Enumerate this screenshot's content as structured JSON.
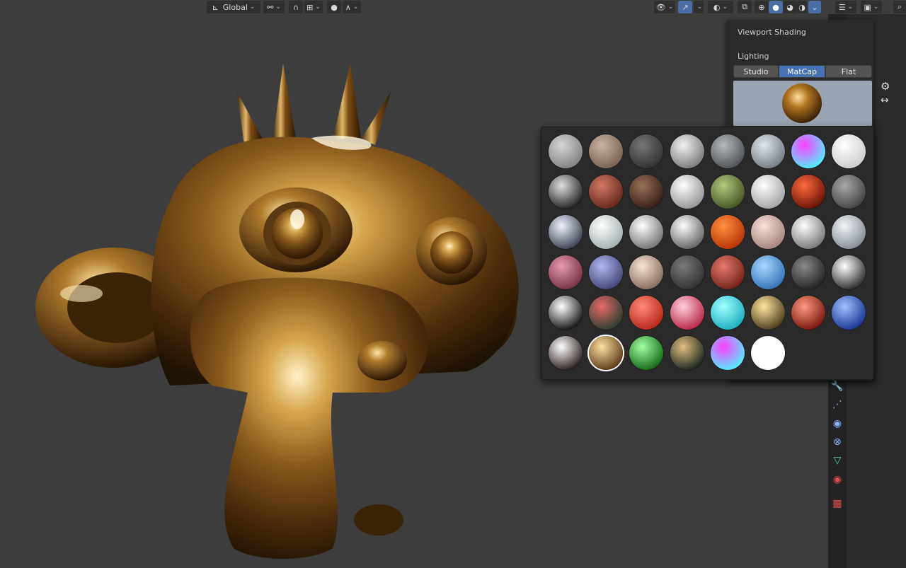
{
  "header": {
    "orientation_label": "Global",
    "icons": [
      "transform-orientation-icon",
      "pivot-icon",
      "snap-icon",
      "snap-target-icon",
      "proportional-edit-icon",
      "falloff-icon",
      "visibility-icon",
      "gizmo-icon",
      "overlay-icon",
      "xray-icon",
      "wireframe-shading-icon",
      "solid-shading-icon",
      "material-shading-icon",
      "rendered-shading-icon",
      "shading-options-icon",
      "outliner-filter-icon",
      "editor-type-icon",
      "search-icon"
    ]
  },
  "shading_popover": {
    "title": "Viewport Shading",
    "lighting_label": "Lighting",
    "lighting_options": [
      "Studio",
      "MatCap",
      "Flat"
    ],
    "active_lighting": "MatCap"
  },
  "matcap_grid": {
    "selected_index": 41,
    "colors": [
      [
        "#d6d6d6",
        "#7a7a7a"
      ],
      [
        "#c9b3a3",
        "#6e5a4c"
      ],
      [
        "#777777",
        "#2a2a2a"
      ],
      [
        "#f2f2f2",
        "#707070"
      ],
      [
        "#b5b9be",
        "#45484c"
      ],
      [
        "#e0e6ec",
        "#6a727a"
      ],
      [
        "#ff40ff",
        "#40ffff"
      ],
      [
        "#ffffff",
        "#c8c8c8"
      ],
      [
        "#e0e0e0",
        "#111111"
      ],
      [
        "#d27a64",
        "#5a1e16"
      ],
      [
        "#9a7058",
        "#2a1812"
      ],
      [
        "#ffffff",
        "#8a8a8a"
      ],
      [
        "#b4c87a",
        "#3a4a20"
      ],
      [
        "#ffffff",
        "#9a9a9a"
      ],
      [
        "#ff6a3c",
        "#5a0a00"
      ],
      [
        "#a8a8a8",
        "#3a3a3a"
      ],
      [
        "#f0f4ff",
        "#2a3040"
      ],
      [
        "#ffffff",
        "#9aa8a8"
      ],
      [
        "#ffffff",
        "#666666"
      ],
      [
        "#ffffff",
        "#555555"
      ],
      [
        "#ff9040",
        "#b02c00"
      ],
      [
        "#f8e0d8",
        "#9a7c74"
      ],
      [
        "#ffffff",
        "#6a6a6a"
      ],
      [
        "#f0f4f8",
        "#7a828a"
      ],
      [
        "#e69ab0",
        "#6a2838"
      ],
      [
        "#b0b8f0",
        "#3a3a6a"
      ],
      [
        "#f8e4d4",
        "#7a6054"
      ],
      [
        "#7a7a7a",
        "#2a2a2a"
      ],
      [
        "#e27a6a",
        "#6a1a14"
      ],
      [
        "#a8d8ff",
        "#2a6ab0"
      ],
      [
        "#8a8a8a",
        "#1a1a1a"
      ],
      [
        "#ffffff",
        "#1a1a1a"
      ],
      [
        "#ffffff",
        "#000000"
      ],
      [
        "#e66a6a",
        "#1a3a2a"
      ],
      [
        "#ff8a7a",
        "#b01e10"
      ],
      [
        "#ffd0dc",
        "#b0163a"
      ],
      [
        "#a0ffff",
        "#10a8b8"
      ],
      [
        "#ffe8a0",
        "#3a2a10"
      ],
      [
        "#ff9a80",
        "#6a0a00"
      ],
      [
        "#a0c0ff",
        "#0a2a8a"
      ],
      [
        "#ffffff",
        "#1a0a0a"
      ],
      [
        "#ffe0a0",
        "#4a2a08"
      ],
      [
        "#a0ffa0",
        "#0a5a0a"
      ],
      [
        "#e0c080",
        "#0a1818"
      ],
      [
        "#ff40ff",
        "#40ffff"
      ],
      [
        "#ffffff",
        "#ffffff"
      ]
    ]
  }
}
